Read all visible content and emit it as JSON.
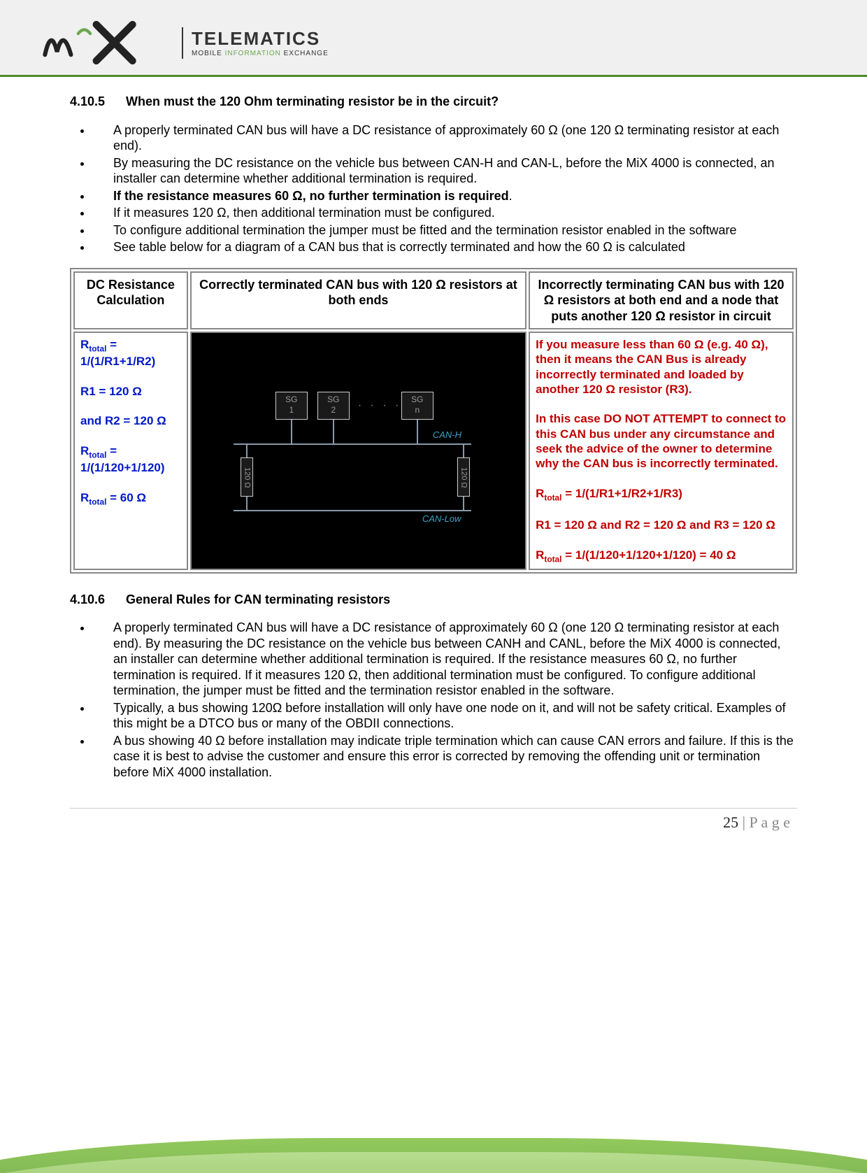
{
  "brand": {
    "top": "TELEMATICS",
    "line2_a": "MOBILE ",
    "line2_b": "INFORMATION ",
    "line2_c": "EXCHANGE"
  },
  "sec1": {
    "num": "4.10.5",
    "title": "When must the 120 Ohm terminating resistor be in the circuit?",
    "bullets": [
      {
        "pre": "A properly terminated CAN bus will have a DC resistance of approximately 60 Ω (one 120 Ω terminating resistor at each end)."
      },
      {
        "pre": "By measuring the DC resistance on the vehicle bus between CAN-H and CAN-L, before the MiX 4000 is connected, an installer can determine whether additional termination is required."
      },
      {
        "bold": "If the resistance measures 60 Ω, no further termination is required",
        "post": "."
      },
      {
        "pre": "If it measures 120 Ω, then additional termination must be configured."
      },
      {
        "pre": "To configure additional termination the jumper must be fitted and the termination resistor enabled in the software"
      },
      {
        "pre": "See table below for a diagram of a CAN bus that is correctly terminated and how the 60 Ω is calculated"
      }
    ]
  },
  "table": {
    "h1": "DC Resistance Calculation",
    "h2": "Correctly terminated CAN bus with 120 Ω resistors at both ends",
    "h3": "Incorrectly terminating CAN bus with 120 Ω resistors at both end and a node that puts another 120 Ω resistor in circuit",
    "calc": {
      "l1a": "R",
      "l1b": "total",
      "l1c": " = 1/(1/R1+1/R2)",
      "l2": "R1 = 120 Ω",
      "l3": "and R2 = 120 Ω",
      "l4a": "R",
      "l4b": "total",
      "l4c": " = 1/(1/120+1/120)",
      "l5a": "R",
      "l5b": "total",
      "l5c": " = 60 Ω"
    },
    "diagram": {
      "sg1": "SG",
      "sg1n": "1",
      "sg2": "SG",
      "sg2n": "2",
      "sgn": "SG",
      "sgnn": "n",
      "r1": "120 Ω",
      "r2": "120 Ω",
      "canh": "CAN-H",
      "canl": "CAN-Low",
      "dots": "· · · ·"
    },
    "warn": {
      "p1": "If you measure less than 60 Ω (e.g. 40 Ω), then it means the CAN Bus is already incorrectly terminated and loaded by another 120 Ω resistor (R3).",
      "p2": "In this case DO NOT ATTEMPT to connect to this CAN bus under any circumstance and seek the advice of the owner to determine why the CAN bus is incorrectly terminated.",
      "l3a": "R",
      "l3b": "total",
      "l3c": " = 1/(1/R1+1/R2+1/R3)",
      "l4": "R1 = 120 Ω and R2 = 120 Ω and R3 = 120 Ω",
      "l5a": "R",
      "l5b": "total",
      "l5c": " = 1/(1/120+1/120+1/120) = 40 Ω"
    }
  },
  "sec2": {
    "num": "4.10.6",
    "title": "General Rules for CAN terminating resistors",
    "bullets": [
      "A properly terminated CAN bus will have a DC resistance of approximately 60 Ω (one 120 Ω terminating resistor at each end). By measuring the DC resistance on the vehicle bus between CANH and CANL, before the MiX 4000 is connected, an installer can determine whether additional termination is required. If the resistance measures 60 Ω, no further termination is required. If it measures 120 Ω, then additional termination must be configured. To configure additional termination, the jumper must be fitted and the termination resistor enabled in the software.",
      "Typically, a bus showing 120Ω before installation will only have one node on it, and will not be safety critical. Examples of this might be a DTCO bus or many of the OBDII connections.",
      "A bus showing 40 Ω before installation may indicate triple termination which can cause CAN errors and failure. If this is the case it is best to advise the customer and ensure this error is corrected by removing the offending unit or termination before MiX 4000 installation."
    ]
  },
  "pagenum": {
    "n": "25",
    "suffix": " | P a g e"
  }
}
